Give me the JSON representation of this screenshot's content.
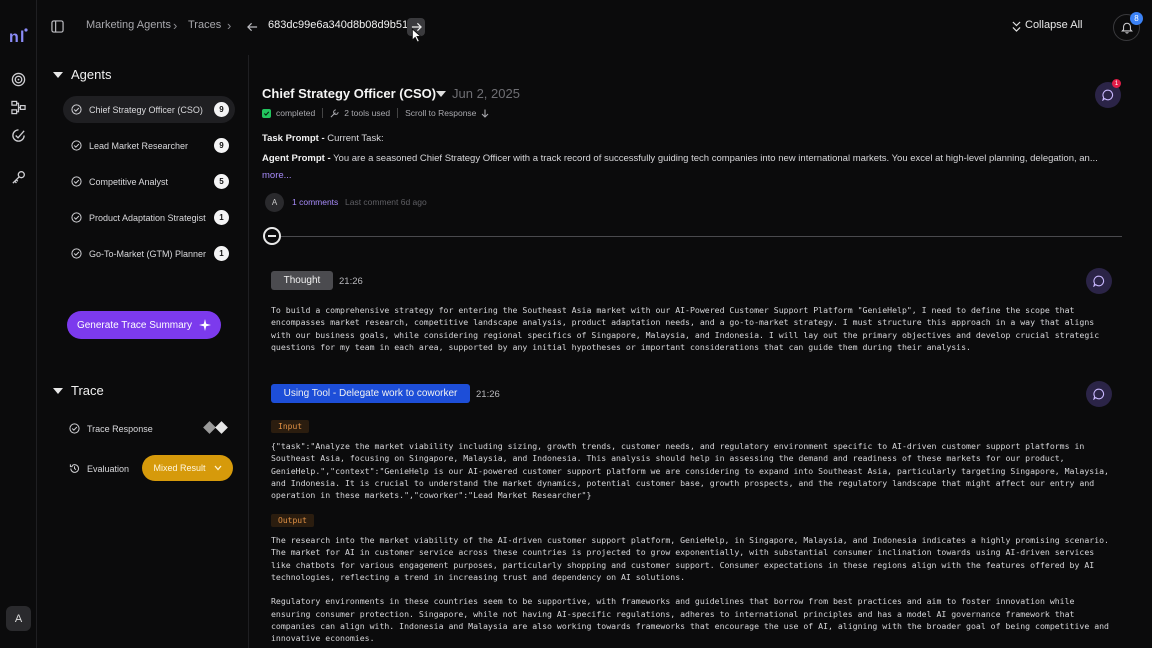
{
  "app": {
    "logo_text": "nl"
  },
  "header": {
    "breadcrumb": [
      "Marketing Agents",
      "Traces"
    ],
    "trace_id": "683dc99e6a340d8b08d9b514",
    "collapse_all_label": "Collapse All",
    "notification_count": "8"
  },
  "sidebar": {
    "agents_heading": "Agents",
    "agents": [
      {
        "name": "Chief Strategy Officer (CSO)",
        "count": "9",
        "active": true
      },
      {
        "name": "Lead Market Researcher",
        "count": "9",
        "active": false
      },
      {
        "name": "Competitive Analyst",
        "count": "5",
        "active": false
      },
      {
        "name": "Product Adaptation Strategist",
        "count": "1",
        "active": false
      },
      {
        "name": "Go-To-Market (GTM) Planner",
        "count": "1",
        "active": false
      }
    ],
    "generate_label": "Generate Trace Summary",
    "trace_heading": "Trace",
    "trace_response_label": "Trace Response",
    "evaluation_label": "Evaluation",
    "evaluation_value": "Mixed Result"
  },
  "user": {
    "initial": "A"
  },
  "main": {
    "agent_name": "Chief Strategy Officer (CSO)",
    "date": "Jun 2, 2025",
    "comment_badge": "1",
    "status": "completed",
    "tools_used": "2 tools used",
    "scroll_label": "Scroll to Response",
    "task_prompt_label": "Task Prompt -",
    "task_prompt_text": " Current Task:",
    "agent_prompt_label": "Agent Prompt -",
    "agent_prompt_text": " You are a seasoned Chief Strategy Officer with a track record of successfully guiding tech companies into new international markets. You excel at high-level planning, delegation, an...",
    "more_label": "more...",
    "commenter_initial": "A",
    "comments_label": "1 comments",
    "last_comment": "Last comment 6d ago",
    "steps": {
      "thought": {
        "label": "Thought",
        "time": "21:26",
        "text": "To build a comprehensive strategy for entering the Southeast Asia market with our AI-Powered Customer Support Platform \"GenieHelp\", I need to define the scope that\nencompasses market research, competitive landscape analysis, product adaptation needs, and a go-to-market strategy. I must structure this approach in a way that aligns\nwith our business goals, while considering regional specifics of Singapore, Malaysia, and Indonesia. I will lay out the primary objectives and develop crucial strategic\nquestions for my team in each area, supported by any initial hypotheses or important considerations that can guide them during their analysis."
      },
      "tool": {
        "label": "Using Tool - Delegate work to coworker",
        "time": "21:26",
        "input_label": "Input",
        "input_text": "{\"task\":\"Analyze the market viability including sizing, growth trends, customer needs, and regulatory environment specific to AI-driven customer support platforms in\nSoutheast Asia, focusing on Singapore, Malaysia, and Indonesia. This analysis should help in assessing the demand and readiness of these markets for our product,\nGenieHelp.\",\"context\":\"GenieHelp is our AI-powered customer support platform we are considering to expand into Southeast Asia, particularly targeting Singapore, Malaysia,\nand Indonesia. It is crucial to understand the market dynamics, potential customer base, growth prospects, and the regulatory landscape that might affect our entry and\noperation in these markets.\",\"coworker\":\"Lead Market Researcher\"}",
        "output_label": "Output",
        "output_text": "The research into the market viability of the AI-driven customer support platform, GenieHelp, in Singapore, Malaysia, and Indonesia indicates a highly promising scenario.\nThe market for AI in customer service across these countries is projected to grow exponentially, with substantial consumer inclination towards using AI-driven services\nlike chatbots for various engagement purposes, particularly shopping and customer support. Consumer expectations in these regions align with the features offered by AI\ntechnologies, reflecting a trend in increasing trust and dependency on AI solutions.\n\nRegulatory environments in these countries seem to be supportive, with frameworks and guidelines that borrow from best practices and aim to foster innovation while\nensuring consumer protection. Singapore, while not having AI-specific regulations, adheres to international principles and has a model AI governance framework that\ncompanies can align with. Indonesia and Malaysia are also working towards frameworks that encourage the use of AI, aligning with the broader goal of being competitive and\ninnovative economies."
      }
    }
  },
  "colors": {
    "accent": "#7c3aed",
    "tool": "#1d4ed8",
    "warning": "#d69a0b",
    "success": "#22c55e"
  }
}
